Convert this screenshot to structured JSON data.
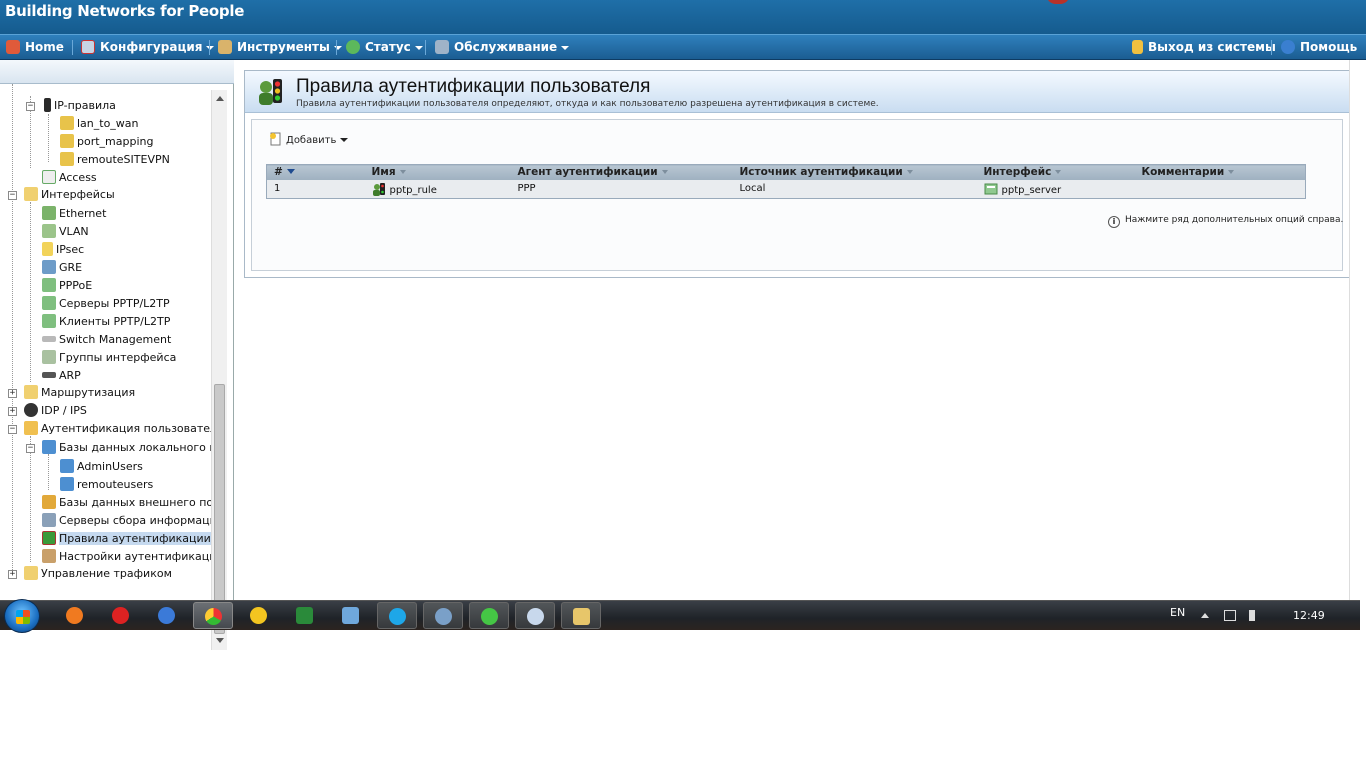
{
  "banner": {
    "brand": "Building Networks for People"
  },
  "menu": {
    "home": "Home",
    "config": "Конфигурация",
    "tools": "Инструменты",
    "status": "Статус",
    "maintenance": "Обслуживание",
    "logout": "Выход из системы",
    "help": "Помощь"
  },
  "tree": {
    "ip_rules": "IP-правила",
    "lan_to_wan": "lan_to_wan",
    "port_mapping": "port_mapping",
    "remoute_sitevpn": "remouteSITEVPN",
    "access": "Access",
    "interfaces": "Интерфейсы",
    "ethernet": "Ethernet",
    "vlan": "VLAN",
    "ipsec": "IPsec",
    "gre": "GRE",
    "pppoe": "PPPoE",
    "pptp_servers": "Серверы PPTP/L2TP",
    "pptp_clients": "Клиенты PPTP/L2TP",
    "switch_mgmt": "Switch Management",
    "iface_groups": "Группы интерфейса",
    "arp": "ARP",
    "routing": "Маршрутизация",
    "idp_ips": "IDP / IPS",
    "user_auth": "Аутентификация пользователя",
    "local_dbs": "Базы данных локального поль",
    "admin_users": "AdminUsers",
    "remoute_users": "remouteusers",
    "external_dbs": "Базы данных внешнего польз",
    "info_servers": "Серверы сбора информации",
    "auth_rules": "Правила аутентификации пол",
    "auth_settings": "Настройки аутентификации",
    "traffic_mgmt": "Управление трафиком"
  },
  "page": {
    "title": "Правила аутентификации пользователя",
    "subtitle": "Правила аутентификации пользователя определяют, откуда и как пользователю разрешена аутентификация в системе.",
    "add_label": "Добавить",
    "hint": "Нажмите ряд дополнительных опций справа."
  },
  "table": {
    "headers": {
      "num": "#",
      "name": "Имя",
      "agent": "Агент аутентификации",
      "source": "Источник аутентификации",
      "iface": "Интерфейс",
      "comment": "Комментарии"
    },
    "rows": [
      {
        "num": "1",
        "name": "pptp_rule",
        "agent": "PPP",
        "source": "Local",
        "iface": "pptp_server",
        "comment": ""
      }
    ]
  },
  "taskbar": {
    "lang": "EN",
    "clock": "12:49"
  }
}
